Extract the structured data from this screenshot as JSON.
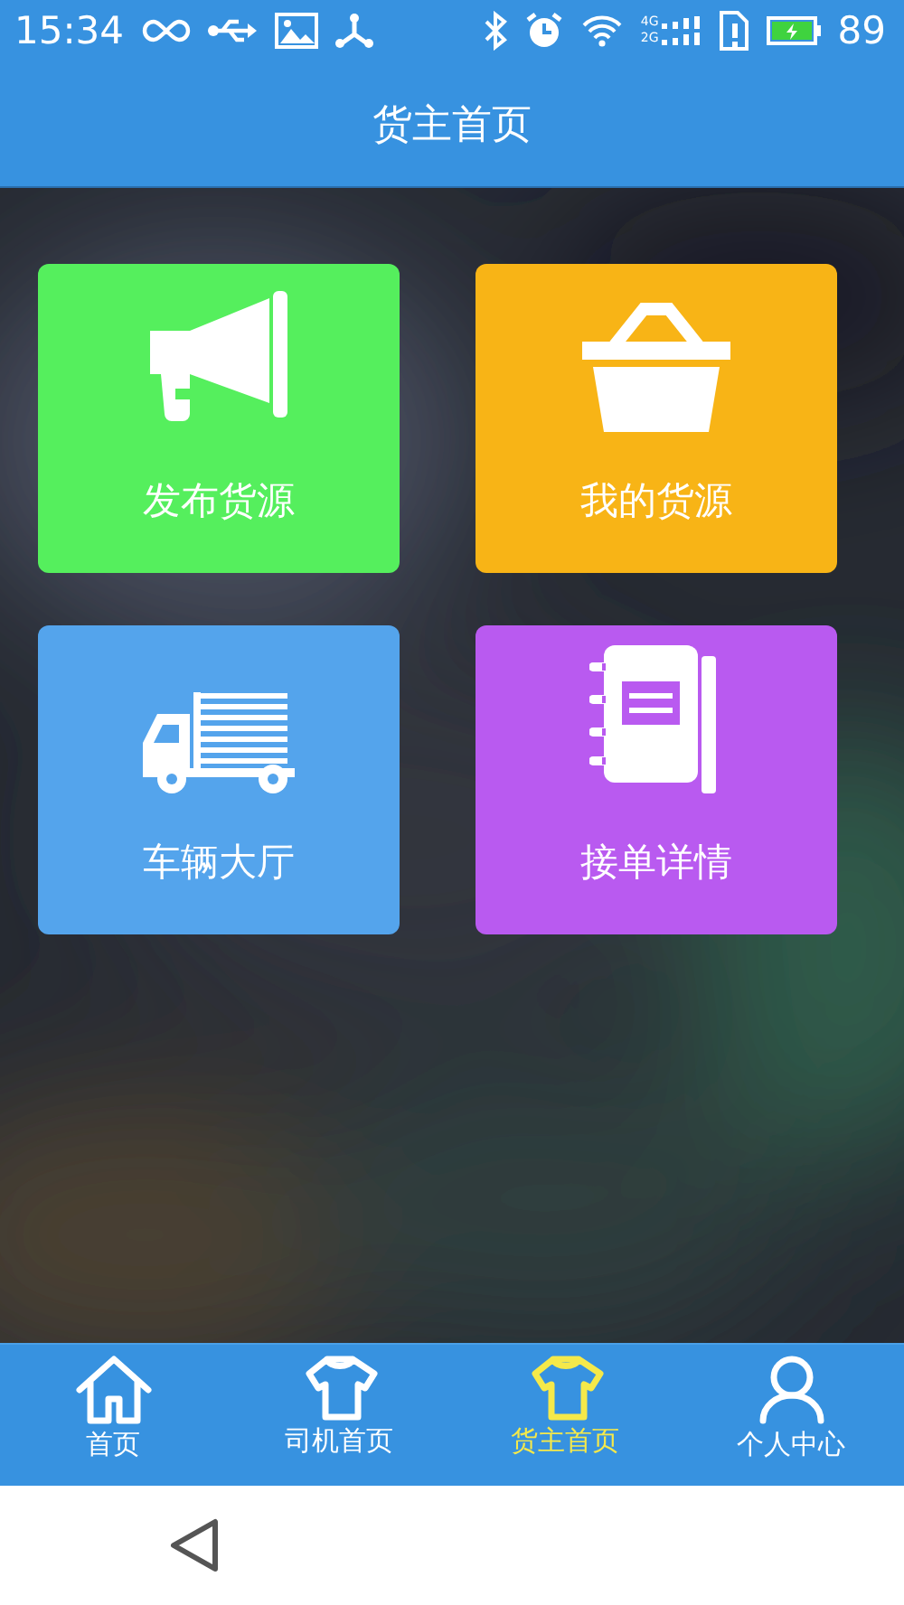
{
  "status_bar": {
    "time": "15:34",
    "network_labels": [
      "4G",
      "2G"
    ],
    "battery": "89"
  },
  "title_bar": {
    "title": "货主首页"
  },
  "tiles": [
    {
      "label": "发布货源",
      "kind": "megaphone",
      "color": "#55ef5d"
    },
    {
      "label": "我的货源",
      "kind": "basket",
      "color": "#f8b416"
    },
    {
      "label": "车辆大厅",
      "kind": "truck",
      "color": "#54a4ec"
    },
    {
      "label": "接单详情",
      "kind": "notebook",
      "color": "#b95af0"
    }
  ],
  "bottom_nav": [
    {
      "label": "首页",
      "kind": "home",
      "selected": false
    },
    {
      "label": "司机首页",
      "kind": "shirt",
      "selected": false
    },
    {
      "label": "货主首页",
      "kind": "shirt",
      "selected": true
    },
    {
      "label": "个人中心",
      "kind": "person",
      "selected": false
    }
  ]
}
